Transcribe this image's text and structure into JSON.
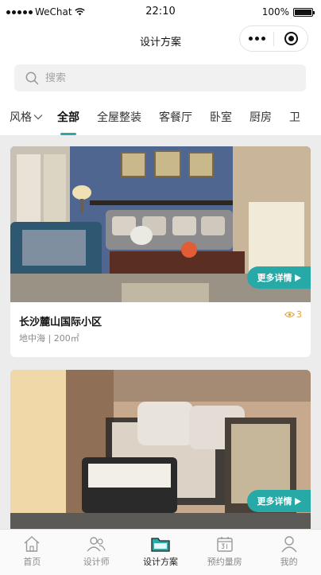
{
  "status_bar": {
    "carrier": "WeChat",
    "time": "22:10",
    "battery": "100%"
  },
  "nav": {
    "title": "设计方案"
  },
  "search": {
    "placeholder": "搜索"
  },
  "tabs": [
    {
      "label": "风格"
    },
    {
      "label": "全部"
    },
    {
      "label": "全屋整装"
    },
    {
      "label": "客餐厅"
    },
    {
      "label": "卧室"
    },
    {
      "label": "厨房"
    },
    {
      "label": "卫"
    }
  ],
  "cards": [
    {
      "more_label": "更多详情",
      "title": "长沙麓山国际小区",
      "meta": "地中海 | 200㎡",
      "views": "3"
    },
    {
      "more_label": "更多详情"
    }
  ],
  "bottom_tabs": [
    {
      "label": "首页",
      "icon": "home-icon"
    },
    {
      "label": "设计师",
      "icon": "designer-icon"
    },
    {
      "label": "设计方案",
      "icon": "folder-icon"
    },
    {
      "label": "预约量房",
      "icon": "calendar-icon"
    },
    {
      "label": "我的",
      "icon": "profile-icon"
    }
  ],
  "colors": {
    "accent": "#27aaa7",
    "views": "#e0a33e"
  }
}
